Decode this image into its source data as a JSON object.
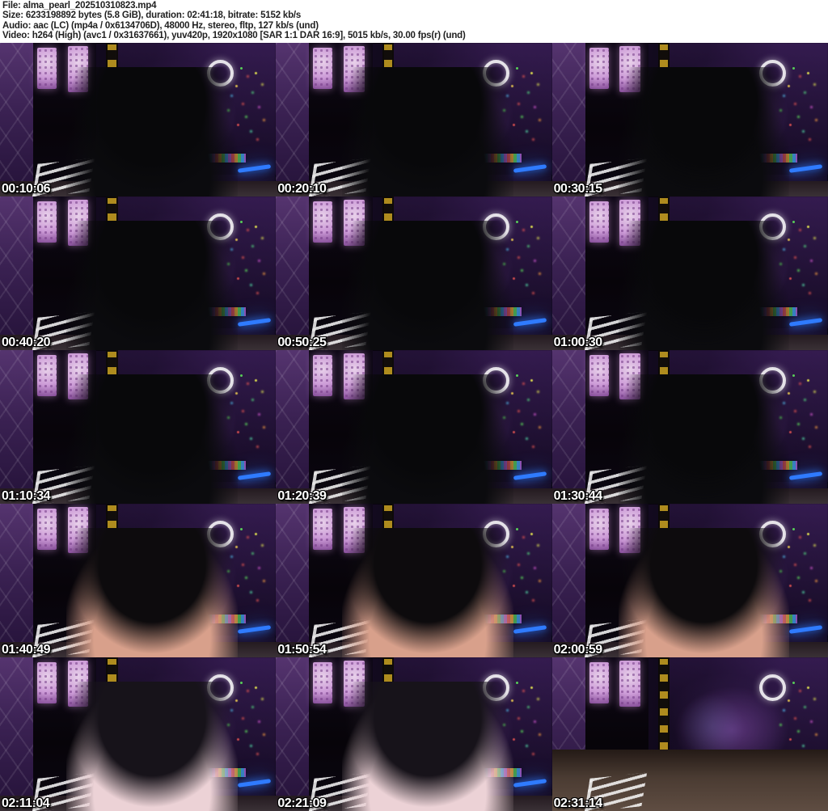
{
  "header": {
    "lines": [
      "File: alma_pearl_202510310823.mp4",
      "Size: 6233198892 bytes (5.8 GiB), duration: 02:41:18, bitrate: 5152 kb/s",
      "Audio: aac (LC) (mp4a / 0x6134706D), 48000 Hz, stereo, fltp, 127 kb/s (und)",
      "Video: h264 (High) (avc1 / 0x31637661), yuv420p, 1920x1080 [SAR 1:1 DAR 16:9], 5015 kb/s, 30.00 fps(r) (und)"
    ]
  },
  "grid": {
    "columns": 3,
    "rows": 5
  },
  "thumbnails": [
    {
      "timestamp": "00:10:06",
      "variant": "dark"
    },
    {
      "timestamp": "00:20:10",
      "variant": "dark"
    },
    {
      "timestamp": "00:30:15",
      "variant": "dark"
    },
    {
      "timestamp": "00:40:20",
      "variant": "dark"
    },
    {
      "timestamp": "00:50:25",
      "variant": "dark"
    },
    {
      "timestamp": "01:00:30",
      "variant": "dark"
    },
    {
      "timestamp": "01:10:34",
      "variant": "dark"
    },
    {
      "timestamp": "01:20:39",
      "variant": "dark"
    },
    {
      "timestamp": "01:30:44",
      "variant": "dark"
    },
    {
      "timestamp": "01:40:49",
      "variant": "warm"
    },
    {
      "timestamp": "01:50:54",
      "variant": "warm"
    },
    {
      "timestamp": "02:00:59",
      "variant": "warm"
    },
    {
      "timestamp": "02:11:04",
      "variant": "pink"
    },
    {
      "timestamp": "02:21:09",
      "variant": "pink"
    },
    {
      "timestamp": "02:31:14",
      "variant": "empty"
    }
  ],
  "colors": {
    "header_bg": "#ffffff",
    "header_text": "#1f1f1f",
    "timestamp_text": "#ffffff",
    "timestamp_outline": "#000000",
    "scene_purple": "#45265e",
    "hex_glow": "#ecc9ef",
    "gold_ornament": "#caa21f",
    "neon_blue": "#2f7bff",
    "ring_light": "#ffffff"
  }
}
